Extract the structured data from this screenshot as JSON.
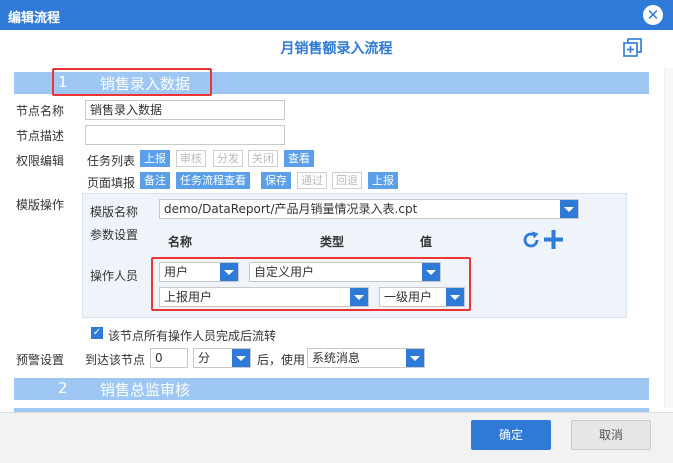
{
  "window": {
    "title": "编辑流程"
  },
  "header": {
    "title": "月销售额录入流程"
  },
  "sections": [
    {
      "num": "1",
      "name": "销售录入数据"
    },
    {
      "num": "2",
      "name": "销售总监审核"
    }
  ],
  "form": {
    "node_name_label": "节点名称",
    "node_name_value": "销售录入数据",
    "node_desc_label": "节点描述",
    "node_desc_value": "",
    "permission_label": "权限编辑",
    "task_list_label": "任务列表",
    "task_tags": [
      {
        "label": "上报",
        "active": true
      },
      {
        "label": "审核",
        "active": false
      },
      {
        "label": "分发",
        "active": false
      },
      {
        "label": "关闭",
        "active": false
      },
      {
        "label": "查看",
        "active": true
      }
    ],
    "page_fill_label": "页面填报",
    "page_tags": [
      {
        "label": "备注",
        "active": true
      },
      {
        "label": "任务流程查看",
        "active": true
      },
      {
        "label": "保存",
        "active": true
      },
      {
        "label": "通过",
        "active": false
      },
      {
        "label": "回退",
        "active": false
      },
      {
        "label": "上报",
        "active": true
      }
    ],
    "template_op_label": "模版操作",
    "template_name_label": "模版名称",
    "template_name_value": "demo/DataReport/产品月销量情况录入表.cpt",
    "param_label": "参数设置",
    "param_headers": [
      "名称",
      "类型",
      "值"
    ],
    "operator_label": "操作人员",
    "operator_type": "用户",
    "operator_mode": "自定义用户",
    "operator_user": "上报用户",
    "operator_level": "一级用户",
    "checkbox_label": "该节点所有操作人员完成后流转",
    "checkbox_checked": true,
    "alert_label": "预警设置",
    "alert_prefix": "到达该节点",
    "alert_value": "0",
    "alert_unit": "分",
    "alert_suffix": "后，使用",
    "alert_method": "系统消息"
  },
  "buttons": {
    "ok": "确定",
    "cancel": "取消"
  },
  "colors": {
    "accent": "#2e7ad6",
    "section_bg": "#9ec8f3",
    "highlight": "#e33333"
  },
  "icons": [
    "close-icon",
    "expand-icon",
    "refresh-icon",
    "add-icon",
    "dropdown-icon",
    "checkbox-icon"
  ]
}
